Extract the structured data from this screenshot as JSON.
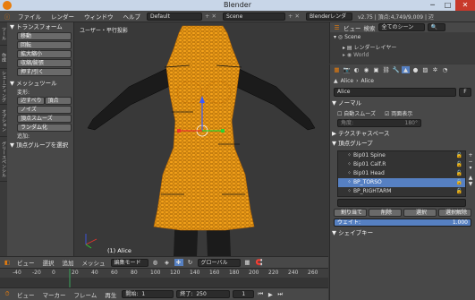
{
  "window": {
    "title": "Blender"
  },
  "menubar": {
    "items": [
      "ファイル",
      "レンダー",
      "ウィンドウ",
      "ヘルプ"
    ],
    "layout": "Default",
    "scene": "Scene",
    "engine": "Blenderレンダー",
    "stats": "v2.75 | 頂点:4,749/9,009 | 辺"
  },
  "toolshelf": {
    "tabs": [
      "ツール",
      "作成",
      "シェーディング",
      "オプション",
      "グリースペンシル"
    ],
    "transform_header": "▼ トランスフォーム",
    "transform_buttons": [
      "移動",
      "回転",
      "拡大縮小",
      "収縮/膨張",
      "押す/引く"
    ],
    "mesh_tools_header": "▼ メッシュツール",
    "deform_label": "変形:",
    "edge_slide": "辺すべり",
    "vertex": "頂点",
    "noise": "ノイズ",
    "smooth_vertex": "頂点スムーズ",
    "randomize": "ランダム化",
    "add_label": "追加:",
    "vg_select": "▼ 頂点グループを選択"
  },
  "viewport": {
    "view_label": "ユーザー・平行投影",
    "object_label": "(1) Alice"
  },
  "viewport_header": {
    "view": "ビュー",
    "select": "選択",
    "add": "追加",
    "mesh": "メッシュ",
    "mode": "編集モード",
    "orientation": "グローバル"
  },
  "timeline": {
    "ticks": [
      "-40",
      "-20",
      "0",
      "20",
      "40",
      "60",
      "80",
      "100",
      "120",
      "140",
      "160",
      "180",
      "200",
      "220",
      "240",
      "260"
    ],
    "view": "ビュー",
    "marker": "マーカー",
    "frame": "フレーム",
    "playback": "再生",
    "start": "開始:",
    "start_val": "1",
    "end": "終了:",
    "end_val": "250",
    "current": "1"
  },
  "outliner": {
    "view": "ビュー",
    "search": "検索",
    "filter": "全てのシーン",
    "rows": [
      "Scene",
      "レンダーレイヤー",
      "World"
    ]
  },
  "properties": {
    "breadcrumb_1": "Alice",
    "breadcrumb_2": "Alice",
    "mesh_name": "Alice",
    "mesh_field_code": "F",
    "normals_header": "▼ ノーマル",
    "auto_smooth": "自動スムーズ",
    "double_sided": "両面表示",
    "angle_label": "角度:",
    "angle_value": "180°",
    "texture_space": "▶ テクスチャスペース",
    "vertex_groups_header": "▼ 頂点グループ",
    "groups": [
      "Bip01 Spine",
      "Bip01 Calf.R",
      "Bip01 Head",
      "BP_TORSO",
      "BP_RIGHTARM"
    ],
    "selected_group": 3,
    "assign": "割り当て",
    "remove": "削除",
    "select": "選択",
    "deselect": "選択解除",
    "weight_label": "ウェイト:",
    "weight_value": "1.000",
    "shape_keys": "▼ シェイプキー"
  },
  "colors": {
    "accent": "#e87d0d",
    "selected": "#5680c2",
    "mesh": "#f5a21a"
  }
}
